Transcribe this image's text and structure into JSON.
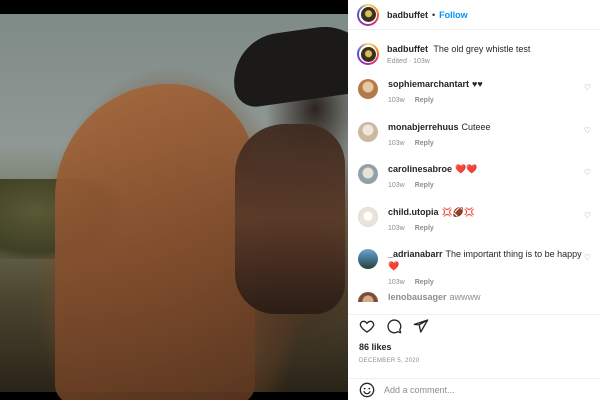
{
  "post": {
    "username": "badbuffet",
    "follow_label": "Follow",
    "separator": "•",
    "caption_user": "badbuffet",
    "caption_text": "The old grey whistle test",
    "caption_meta": "Edited · 103w",
    "likes": "86 likes",
    "date": "DECEMBER 5, 2020",
    "add_comment_placeholder": "Add a comment..."
  },
  "comments": [
    {
      "user": "sophiemarchantart",
      "text": "♥♥",
      "age": "103w",
      "reply": "Reply"
    },
    {
      "user": "monabjerrehuus",
      "text": "Cuteee",
      "age": "103w",
      "reply": "Reply"
    },
    {
      "user": "carolinesabroe",
      "text": "❤️❤️",
      "age": "103w",
      "reply": "Reply"
    },
    {
      "user": "child.utopia",
      "text": "💢🏈💢",
      "age": "103w",
      "reply": "Reply"
    },
    {
      "user": "_adrianabarr",
      "text": "The important thing is to be happy❤️",
      "age": "103w",
      "reply": "Reply"
    },
    {
      "user": "lenobausager",
      "text": "awwww",
      "age": "",
      "reply": ""
    }
  ],
  "icons": {
    "like": "heart-outline-icon",
    "comment": "comment-bubble-icon",
    "share": "paper-plane-icon",
    "emoji": "smiley-face-icon",
    "comment_like": "small-heart-icon"
  }
}
